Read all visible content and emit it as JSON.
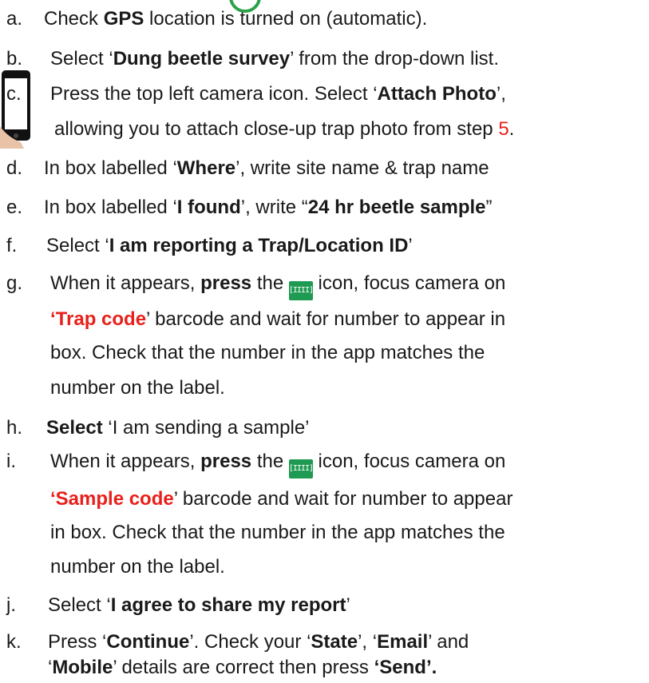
{
  "steps": [
    {
      "marker": "a.",
      "parts": [
        "Check ",
        "GPS",
        " location is turned on (automatic)."
      ]
    },
    {
      "marker": "b.",
      "parts": [
        "Select ‘",
        "Dung beetle survey",
        "’ from the drop-down list."
      ]
    },
    {
      "marker": "c.",
      "lines": [
        [
          "Press the top left camera icon. Select ‘",
          "Attach Photo",
          "’,"
        ],
        [
          "allowing you to attach close-up trap photo from step ",
          "5",
          "."
        ]
      ]
    },
    {
      "marker": "d.",
      "parts": [
        "In box labelled ‘",
        "Where",
        "’, write site name & trap name"
      ]
    },
    {
      "marker": "e.",
      "parts": [
        "In box labelled ‘",
        "I found",
        "’, write “",
        "24 hr beetle sample",
        "”"
      ]
    },
    {
      "marker": "f.",
      "parts": [
        "Select ‘",
        "I am reporting a Trap/Location ID",
        "’"
      ]
    },
    {
      "marker": "g.",
      "lines": [
        [
          "When it appears, ",
          "press",
          " the ",
          "icon, focus camera on"
        ],
        [
          "‘Trap code",
          "’ barcode and wait for number to appear in"
        ],
        [
          "box. Check that the number in the app matches the"
        ],
        [
          "number on the label."
        ]
      ]
    },
    {
      "marker": "h.",
      "parts": [
        "Select",
        " ‘I am sending a sample’"
      ]
    },
    {
      "marker": "i.",
      "lines": [
        [
          "When it appears, ",
          "press",
          " the ",
          "icon, focus camera on"
        ],
        [
          "‘Sample code",
          "’ barcode and wait for number to appear"
        ],
        [
          "in box. Check that the number in the app matches the"
        ],
        [
          "number on the label."
        ]
      ]
    },
    {
      "marker": "j.",
      "parts": [
        "Select ‘",
        "I agree to share my report",
        "’"
      ]
    },
    {
      "marker": "k.",
      "lines": [
        [
          "Press ‘",
          "Continue",
          "’. Check your ‘",
          "State",
          "’, ‘",
          "Email",
          "’ and"
        ],
        [
          "‘",
          "Mobile",
          "’ details are correct then press ",
          "‘Send’."
        ]
      ]
    }
  ],
  "icons": {
    "barcode_glyph": "[IIII]",
    "barcode_color": "#1f9a52",
    "accent_red": "#e8201b"
  }
}
